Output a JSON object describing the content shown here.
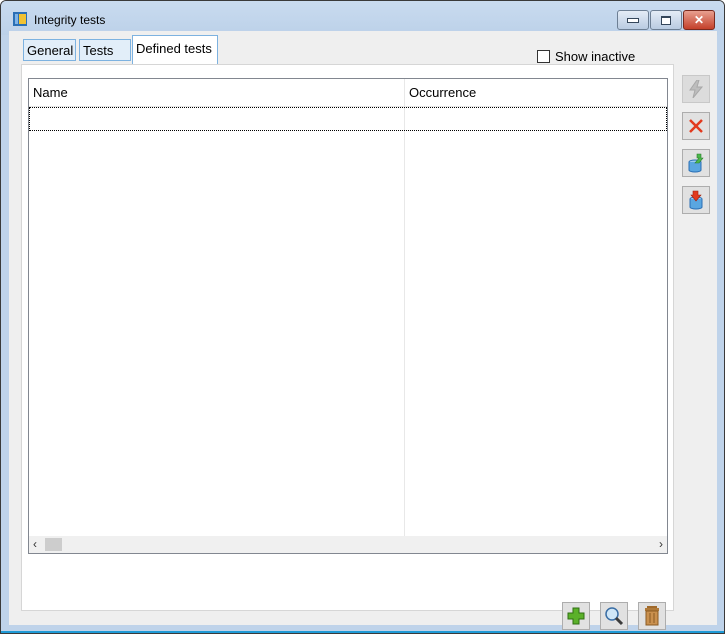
{
  "window": {
    "title": "Integrity tests",
    "icon": "app-icon",
    "controls": {
      "minimize": "minimize",
      "maximize": "maximize",
      "close": "close"
    }
  },
  "tabs": [
    {
      "label": "General",
      "active": false
    },
    {
      "label": "Tests",
      "active": false
    },
    {
      "label": "Defined tests",
      "active": true
    }
  ],
  "filters": {
    "show_inactive_label": "Show inactive",
    "show_inactive_checked": false
  },
  "grid": {
    "columns": [
      {
        "label": "Name"
      },
      {
        "label": "Occurrence"
      }
    ],
    "rows": [],
    "scroll_left_glyph": "‹",
    "scroll_right_glyph": "›"
  },
  "side_toolbar": [
    {
      "name": "run-icon",
      "enabled": false
    },
    {
      "name": "cancel-icon",
      "enabled": true
    },
    {
      "name": "export-icon",
      "enabled": true
    },
    {
      "name": "import-icon",
      "enabled": true
    }
  ],
  "bottom_toolbar": [
    {
      "name": "add-icon"
    },
    {
      "name": "view-icon"
    },
    {
      "name": "delete-icon"
    }
  ],
  "colors": {
    "accent": "#7db2e0",
    "frame": "#bfd3ea",
    "close": "#c4402a"
  }
}
